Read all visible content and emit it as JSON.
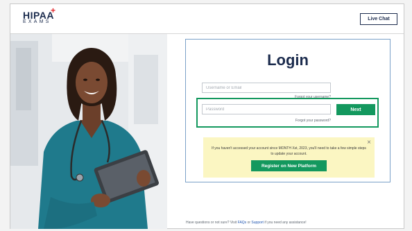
{
  "header": {
    "logo_main": "HIPAA",
    "logo_plus": "+",
    "logo_sub": "EXAMS",
    "live_chat_label": "Live Chat"
  },
  "photo": {
    "description_icon": "nurse-with-tablet-photo"
  },
  "login": {
    "title": "Login",
    "username_placeholder": "Username or Email",
    "username_value": "",
    "forgot_username": "Forgot your username?",
    "password_placeholder": "Password",
    "password_value": "",
    "next_label": "Next",
    "forgot_password": "Forgot your password?"
  },
  "notice": {
    "text": "If you haven't accessed your account since MONTH Xst, 2023, you'll need to take a few simple steps to update your account.",
    "close_icon": "×",
    "register_label": "Register on New Platform"
  },
  "footer": {
    "prefix": "Have questions or not sure? Visit ",
    "faqs": "FAQs",
    "or": " or ",
    "support": "Support",
    "suffix": " if you need any assistance!"
  },
  "colors": {
    "brand_navy": "#1b2b4d",
    "accent_green": "#13985e",
    "logo_red": "#e2262b",
    "notice_yellow": "#fbf6c2",
    "card_border": "#7aa0c8"
  }
}
